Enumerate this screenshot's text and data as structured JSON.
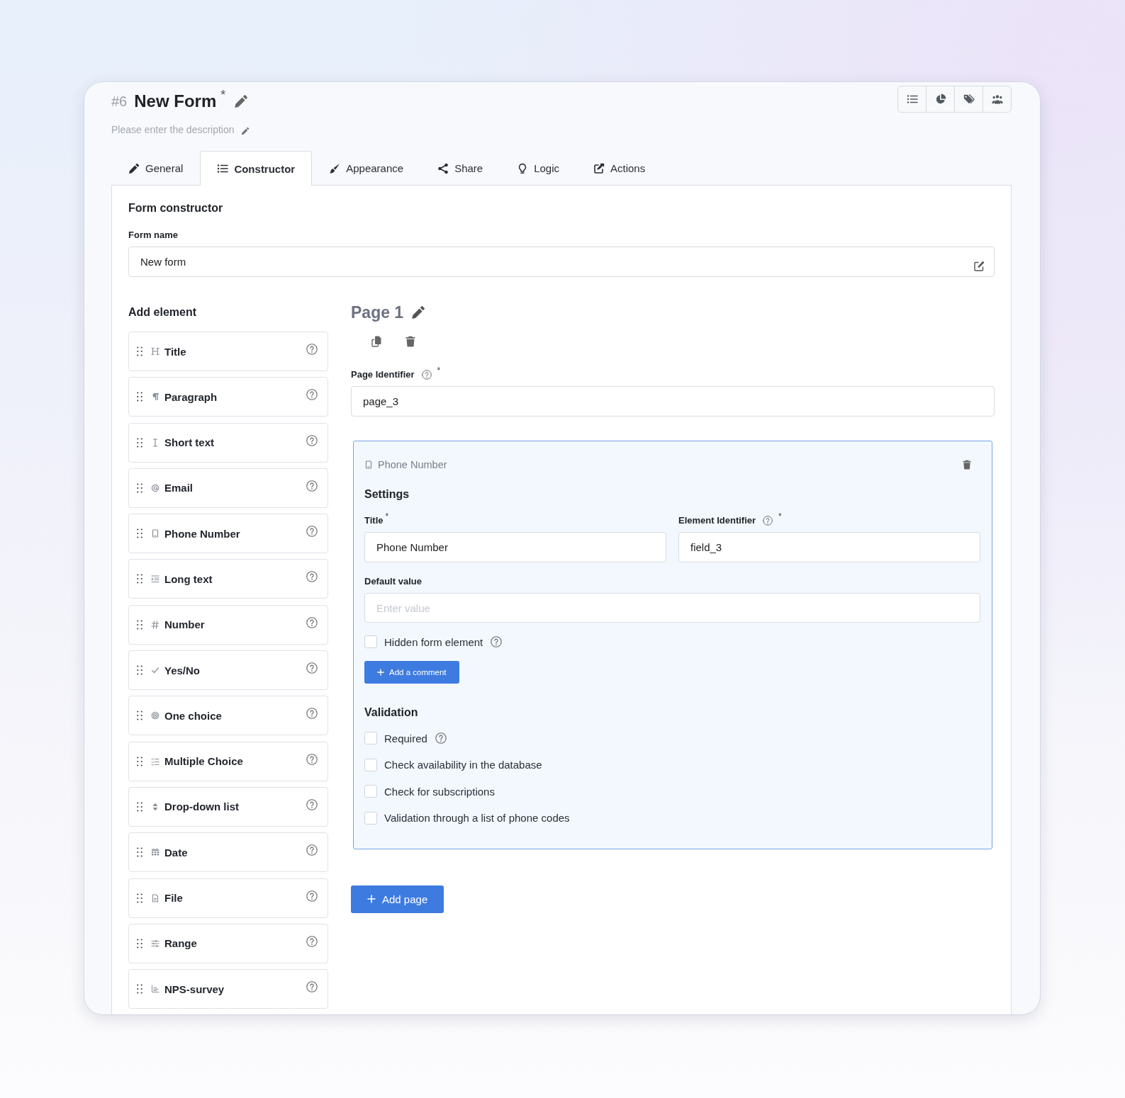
{
  "header": {
    "number": "#6",
    "title": "New Form",
    "title_mark": "*",
    "description_hint": "Please enter the description"
  },
  "tabs": [
    {
      "label": "General",
      "selected": false
    },
    {
      "label": "Constructor",
      "selected": true
    },
    {
      "label": "Appearance",
      "selected": false
    },
    {
      "label": "Share",
      "selected": false
    },
    {
      "label": "Logic",
      "selected": false
    },
    {
      "label": "Actions",
      "selected": false
    }
  ],
  "constructor": {
    "title": "Form constructor",
    "form_name": {
      "label": "Form name",
      "value": "New form"
    }
  },
  "add_element": {
    "title": "Add element",
    "items": [
      {
        "label": "Title"
      },
      {
        "label": "Paragraph"
      },
      {
        "label": "Short text"
      },
      {
        "label": "Email"
      },
      {
        "label": "Phone Number"
      },
      {
        "label": "Long text"
      },
      {
        "label": "Number"
      },
      {
        "label": "Yes/No"
      },
      {
        "label": "One choice"
      },
      {
        "label": "Multiple Choice"
      },
      {
        "label": "Drop-down list"
      },
      {
        "label": "Date"
      },
      {
        "label": "File"
      },
      {
        "label": "Range"
      },
      {
        "label": "NPS-survey"
      }
    ]
  },
  "page": {
    "title": "Page 1",
    "identifier": {
      "label": "Page Identifier",
      "help": true,
      "required_mark": "*",
      "value": "page_3"
    }
  },
  "element": {
    "type": "Phone Number",
    "settings_title": "Settings",
    "fields": [
      {
        "label": "Title",
        "help": false,
        "required_mark": "*",
        "value": "Phone Number"
      },
      {
        "label": "Element Identifier",
        "help": true,
        "required_mark": "*",
        "value": "field_3"
      }
    ],
    "default_value": {
      "label": "Default value",
      "placeholder": "Enter value"
    },
    "hidden_option": {
      "label": "Hidden form element",
      "checked": false,
      "help": true
    },
    "comment_button": "Add a comment",
    "validation": {
      "title": "Validation",
      "options": [
        {
          "label": "Required",
          "checked": false,
          "help": true
        },
        {
          "label": "Check availability in the database",
          "checked": false,
          "help": false
        },
        {
          "label": "Check for subscriptions",
          "checked": false,
          "help": false
        },
        {
          "label": "Validation through a list of phone codes",
          "checked": false,
          "help": false
        }
      ]
    }
  },
  "add_page_button": "Add page"
}
